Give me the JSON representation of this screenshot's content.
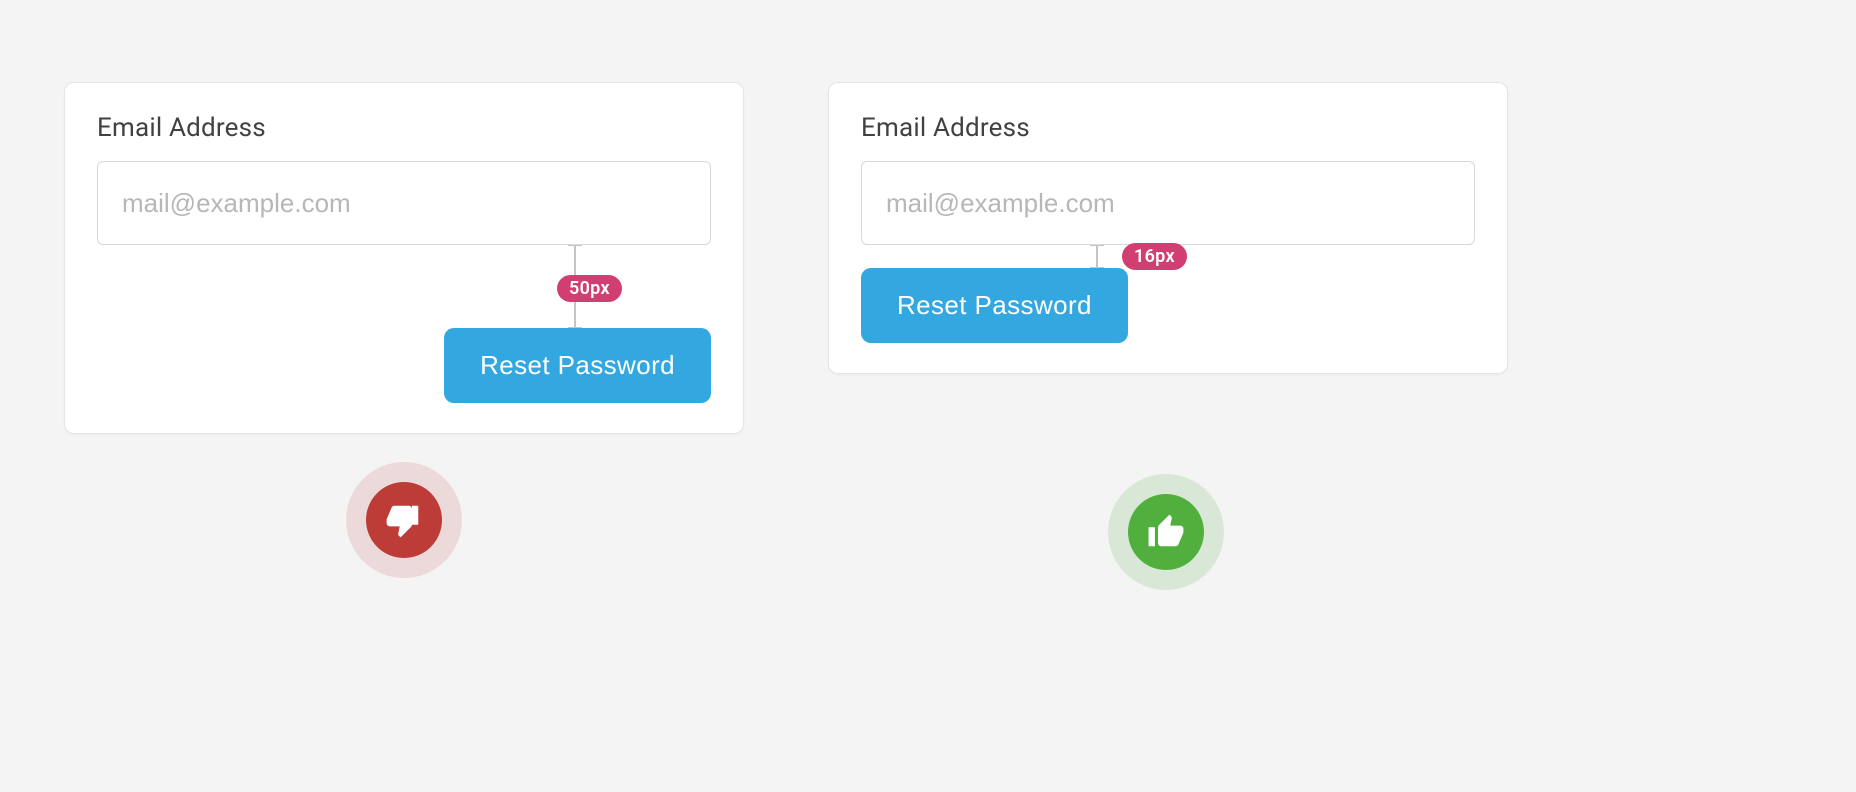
{
  "bad": {
    "label": "Email Address",
    "placeholder": "mail@example.com",
    "spacing_badge": "50px",
    "button": "Reset Password"
  },
  "good": {
    "label": "Email Address",
    "placeholder": "mail@example.com",
    "spacing_badge": "16px",
    "button": "Reset Password"
  }
}
